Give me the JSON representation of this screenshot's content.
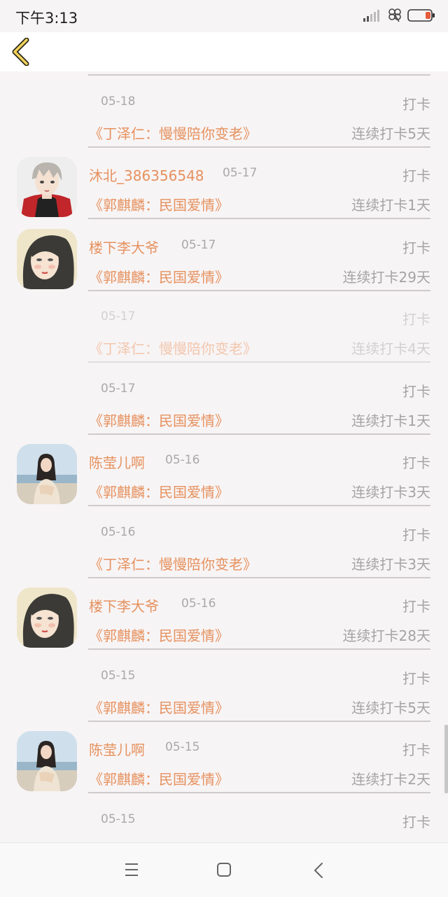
{
  "status_bar": {
    "time": "下午3:13"
  },
  "feed": {
    "entries": [
      {
        "user": "",
        "date": "",
        "action": "",
        "book": "《郭麒麟：民国爱情》",
        "streak": "连续打卡2天",
        "avatar": ""
      },
      {
        "user": "",
        "date": "05-18",
        "action": "打卡",
        "book": "《丁泽仁：慢慢陪你变老》",
        "streak": "连续打卡5天",
        "avatar": ""
      },
      {
        "user": "沐北_386356548",
        "date": "05-17",
        "action": "打卡",
        "book": "《郭麒麟：民国爱情》",
        "streak": "连续打卡1天",
        "avatar": "anime-boy"
      },
      {
        "user": "楼下李大爷",
        "date": "05-17",
        "action": "打卡",
        "book": "《郭麒麟：民国爱情》",
        "streak": "连续打卡29天",
        "avatar": "painted-woman"
      },
      {
        "user": "",
        "date": "05-17",
        "action": "打卡",
        "book": "《丁泽仁：慢慢陪你变老》",
        "streak": "连续打卡4天",
        "avatar": "",
        "faded": true
      },
      {
        "user": "",
        "date": "05-17",
        "action": "打卡",
        "book": "《郭麒麟：民国爱情》",
        "streak": "连续打卡1天",
        "avatar": ""
      },
      {
        "user": "陈莹儿啊",
        "date": "05-16",
        "action": "打卡",
        "book": "《郭麒麟：民国爱情》",
        "streak": "连续打卡3天",
        "avatar": "beach-girl"
      },
      {
        "user": "",
        "date": "05-16",
        "action": "打卡",
        "book": "《丁泽仁：慢慢陪你变老》",
        "streak": "连续打卡3天",
        "avatar": ""
      },
      {
        "user": "楼下李大爷",
        "date": "05-16",
        "action": "打卡",
        "book": "《郭麒麟：民国爱情》",
        "streak": "连续打卡28天",
        "avatar": "painted-woman"
      },
      {
        "user": "",
        "date": "05-15",
        "action": "打卡",
        "book": "《郭麒麟：民国爱情》",
        "streak": "连续打卡5天",
        "avatar": ""
      },
      {
        "user": "陈莹儿啊",
        "date": "05-15",
        "action": "打卡",
        "book": "《郭麒麟：民国爱情》",
        "streak": "连续打卡2天",
        "avatar": "beach-girl"
      },
      {
        "user": "",
        "date": "05-15",
        "action": "打卡",
        "book": "",
        "streak": "",
        "avatar": ""
      }
    ]
  },
  "colors": {
    "accent": "#e6915e",
    "muted_text": "#a4a4a4",
    "background": "#f7f4f5"
  },
  "icons": {
    "back": "chevron-left-icon",
    "nav": [
      "menu-icon",
      "home-square-icon",
      "back-triangle-icon"
    ]
  }
}
